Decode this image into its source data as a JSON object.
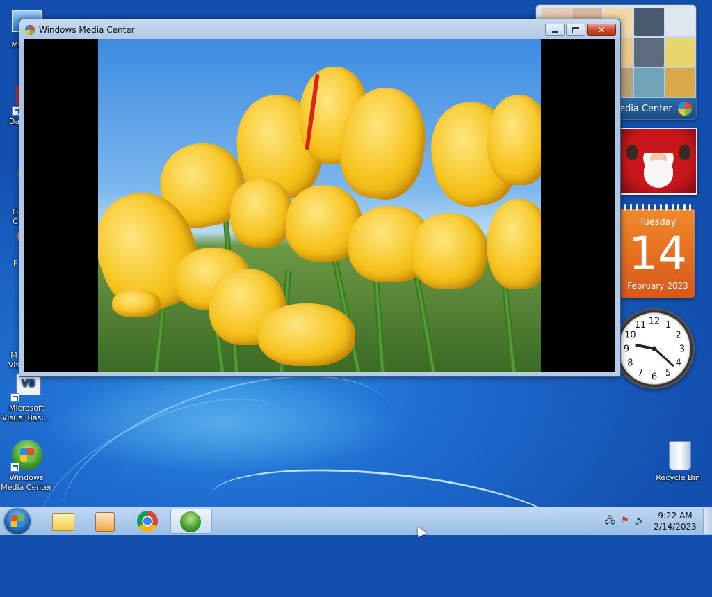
{
  "window": {
    "title": "Windows Media Center",
    "controls": {
      "minimize": "minimize",
      "maximize": "maximize",
      "close": "close"
    }
  },
  "desktop_icons": [
    {
      "label": "My C",
      "icon": "computer-icon"
    },
    {
      "label": "Data",
      "icon": "database-icon"
    },
    {
      "label": "G\nC",
      "icon": "chrome-icon"
    },
    {
      "label": "F",
      "icon": "firefox-icon"
    },
    {
      "label": "M\nVis",
      "icon": "visual-studio-icon"
    },
    {
      "label": "Microsoft Visual Basi...",
      "icon": "visual-basic-icon"
    },
    {
      "label": "Windows Media Center",
      "icon": "media-center-icon"
    },
    {
      "label": "Recycle Bin",
      "icon": "recycle-bin-icon"
    }
  ],
  "gadgets": {
    "media_center": {
      "label": "edia Center"
    },
    "calendar": {
      "weekday": "Tuesday",
      "day": "14",
      "month_year": "February 2023"
    },
    "clock": {
      "hour": 9,
      "minute": 22
    },
    "clock_numbers": [
      "12",
      "1",
      "2",
      "3",
      "4",
      "5",
      "6",
      "7",
      "8",
      "9",
      "10",
      "11"
    ]
  },
  "taskbar": {
    "pinned": [
      {
        "name": "explorer",
        "icon": "folder-icon"
      },
      {
        "name": "media-player",
        "icon": "media-player-icon"
      },
      {
        "name": "chrome",
        "icon": "chrome-icon"
      },
      {
        "name": "media-center",
        "icon": "media-center-icon",
        "active": true
      }
    ],
    "tray": {
      "time": "9:22 AM",
      "date": "2/14/2023"
    }
  },
  "colors": {
    "accent": "#1f6ed2",
    "calendar": "#e46e22",
    "close": "#c8482d"
  }
}
